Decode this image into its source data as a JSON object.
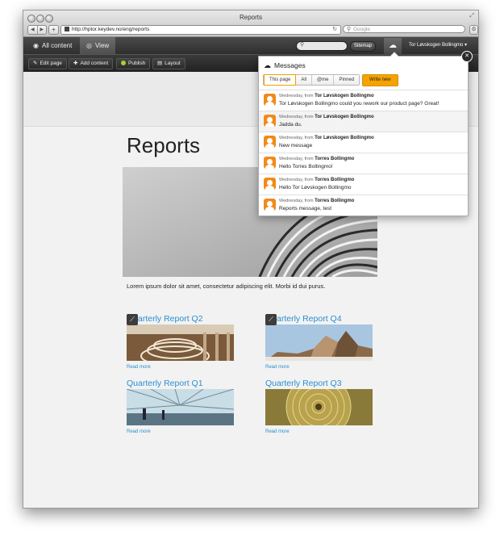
{
  "window": {
    "title": "Reports"
  },
  "browser": {
    "url": "http://hptor.keydev.no/eng/reports",
    "search_placeholder": "Google"
  },
  "cms": {
    "tabs": [
      {
        "label": "All content"
      },
      {
        "label": "View"
      }
    ],
    "sitemap_label": "Sitemap",
    "user_name": "Tor Løvskogen Bollingmo",
    "tools": {
      "edit": "Edit page",
      "add": "Add content",
      "publish": "Publish",
      "layout": "Layout"
    }
  },
  "page": {
    "title": "Reports",
    "lorem": "Lorem ipsum dolor sit amet, consectetur adipiscing elit. Morbi id dui purus.",
    "reports": [
      {
        "title": "Quarterly Report Q2",
        "read_more": "Read more"
      },
      {
        "title": "Quarterly Report Q4",
        "read_more": "Read more"
      },
      {
        "title": "Quarterly Report Q1",
        "read_more": "Read more"
      },
      {
        "title": "Quarterly Report Q3",
        "read_more": "Read more"
      }
    ]
  },
  "messages": {
    "header": "Messages",
    "filters": [
      "This page",
      "All",
      "@me",
      "Pinned"
    ],
    "write_label": "Write new",
    "items": [
      {
        "meta": "Wednesday, from",
        "author": "Tor Løvskogen Bollingmo",
        "text": "Tor Løvskogen Bollingmo could you rework our product page? Great!"
      },
      {
        "meta": "Wednesday, from",
        "author": "Tor Løvskogen Bollingmo",
        "text": "Jadda du."
      },
      {
        "meta": "Wednesday, from",
        "author": "Tor Løvskogen Bollingmo",
        "text": "New message"
      },
      {
        "meta": "Wednesday, from",
        "author": "Torres Bollingmo",
        "text": "Hello Torres Bollingmo!"
      },
      {
        "meta": "Wednesday, from",
        "author": "Torres Bollingmo",
        "text": "Hello Tor Løvskogen Bollingmo"
      },
      {
        "meta": "Wednesday, from",
        "author": "Torres Bollingmo",
        "text": "Reports message, test"
      }
    ]
  },
  "colors": {
    "link": "#2a8fd0",
    "write_button": "#f5a300",
    "avatar": "#f28a1a",
    "publish_dot": "#a4d12f"
  }
}
